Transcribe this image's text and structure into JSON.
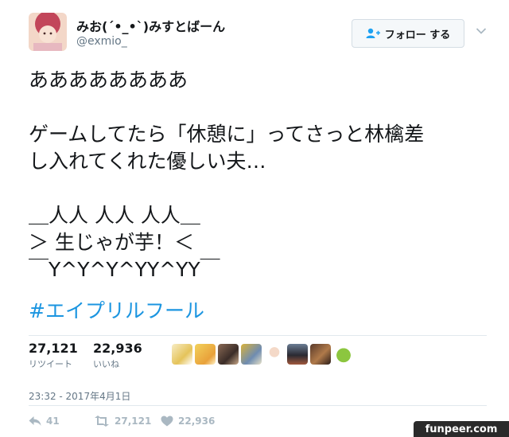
{
  "user": {
    "display_name": "みお(´•_•`)みすとばーん",
    "handle": "@exmio_",
    "avatar_icon": "user-avatar"
  },
  "header": {
    "follow_label": "フォロー する",
    "follow_icon": "add-user-icon",
    "menu_icon": "chevron-down-icon"
  },
  "tweet": {
    "lines": [
      "ああああああああ",
      "",
      "ゲームしてたら「休憩に」ってさっと林檎差",
      "し入れてくれた優しい夫…",
      "",
      "＿人人 人人 人人＿",
      "＞ 生じゃが芋！＜",
      "￣Y^Y^Y^YY^YY￣"
    ],
    "hashtag": "#エイプリルフール"
  },
  "stats": {
    "retweets_count": "27,121",
    "retweets_label": "リツイート",
    "likes_count": "22,936",
    "likes_label": "いいね"
  },
  "liker_avatars": [
    "liker-1",
    "liker-2",
    "liker-3",
    "liker-4",
    "liker-5",
    "liker-6",
    "liker-7",
    "liker-8"
  ],
  "timestamp": "23:32 - 2017年4月1日",
  "actions": {
    "reply_count": "41",
    "retweet_count": "27,121",
    "like_count": "22,936"
  },
  "watermark": "funpeer.com",
  "colors": {
    "hashtag": "#1b95e0",
    "muted": "#657786",
    "action_icons": "#aab8c2"
  }
}
